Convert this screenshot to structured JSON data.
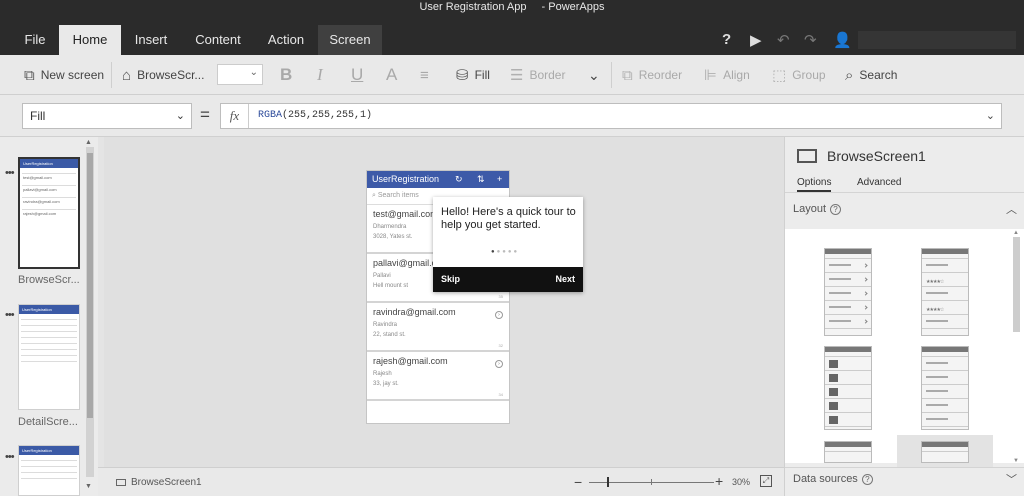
{
  "title": {
    "app": "User Registration App",
    "product": "- PowerApps"
  },
  "menu": {
    "tabs": [
      "File",
      "Home",
      "Insert",
      "Content",
      "Action",
      "Screen"
    ],
    "active": "Home"
  },
  "ribbon": {
    "new_screen": "New screen",
    "browse_screen": "BrowseScr...",
    "fill": "Fill",
    "border": "Border",
    "reorder": "Reorder",
    "align": "Align",
    "group": "Group",
    "search": "Search"
  },
  "formula": {
    "property": "Fill",
    "fx": "fx",
    "equals": "=",
    "fn": "RGBA",
    "args": "(255,255,255,1)"
  },
  "thumbnails": [
    {
      "label": "BrowseScr...",
      "header": "UserRegistration",
      "selected": true
    },
    {
      "label": "DetailScre...",
      "header": "UserRegistration",
      "selected": false
    },
    {
      "label": "",
      "header": "UserRegistration",
      "selected": false
    }
  ],
  "phone": {
    "header": "UserRegistration",
    "search_placeholder": "Search items",
    "records": [
      {
        "email": "test@gmail.com",
        "name": "Dharmendra",
        "address": "3028, Yates st.",
        "id": ""
      },
      {
        "email": "pallavi@gmail.com",
        "name": "Pallavi",
        "address": "Hell mount st",
        "id": "35"
      },
      {
        "email": "ravindra@gmail.com",
        "name": "Ravindra",
        "address": "22, stand st.",
        "id": "32"
      },
      {
        "email": "rajesh@gmail.com",
        "name": "Rajesh",
        "address": "33, jay st.",
        "id": "34"
      }
    ]
  },
  "tour": {
    "text": "Hello! Here's a quick tour to help you get started.",
    "skip": "Skip",
    "next": "Next",
    "steps": 5,
    "current": 1
  },
  "status": {
    "screen": "BrowseScreen1",
    "zoom": "30%",
    "minus": "−",
    "plus": "+"
  },
  "rightpanel": {
    "title": "BrowseScreen1",
    "tabs": [
      "Options",
      "Advanced"
    ],
    "active_tab": "Options",
    "layout_label": "Layout",
    "datasources_label": "Data sources"
  },
  "colors": {
    "chrome": "#2b2b2b",
    "accent": "#3d5aa8",
    "tour_footer": "#111111"
  }
}
